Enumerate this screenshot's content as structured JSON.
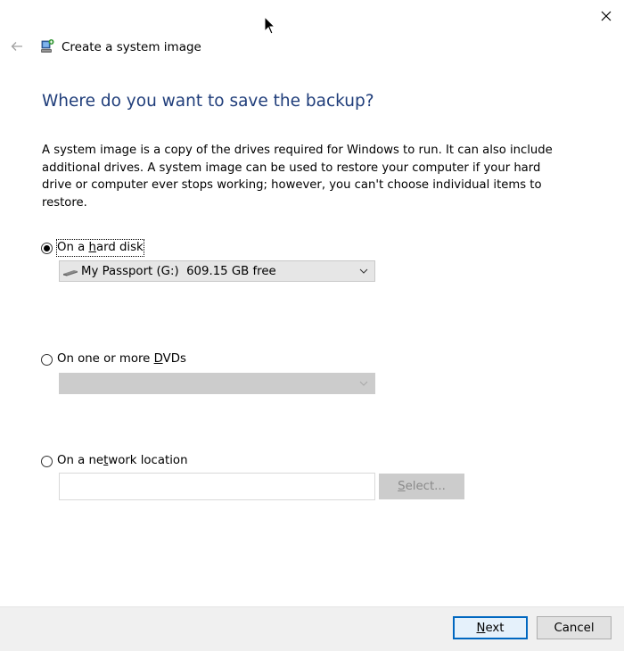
{
  "window": {
    "title": "Create a system image",
    "close_icon": "close-icon",
    "back_icon": "back-arrow-icon",
    "app_icon": "system-image-icon"
  },
  "page": {
    "heading": "Where do you want to save the backup?",
    "description": "A system image is a copy of the drives required for Windows to run. It can also include additional drives. A system image can be used to restore your computer if your hard drive or computer ever stops working; however, you can't choose individual items to restore."
  },
  "options": {
    "hard_disk": {
      "label_before": "On a ",
      "label_access": "h",
      "label_after": "ard disk",
      "selected": true,
      "dropdown_value": "My Passport (G:)  609.15 GB free",
      "dropdown_icon": "drive-icon"
    },
    "dvds": {
      "label_before": "On one or more ",
      "label_access": "D",
      "label_after": "VDs",
      "selected": false,
      "dropdown_value": ""
    },
    "network": {
      "label_before": "On a ne",
      "label_access": "t",
      "label_after": "work location",
      "selected": false,
      "input_value": "",
      "select_access": "S",
      "select_rest": "elect..."
    }
  },
  "footer": {
    "next_access": "N",
    "next_rest": "ext",
    "cancel_label": "Cancel"
  },
  "colors": {
    "heading": "#1f3d7a",
    "accent": "#0078d7",
    "footer_bg": "#f0f0f0",
    "disabled_bg": "#cccccc"
  }
}
